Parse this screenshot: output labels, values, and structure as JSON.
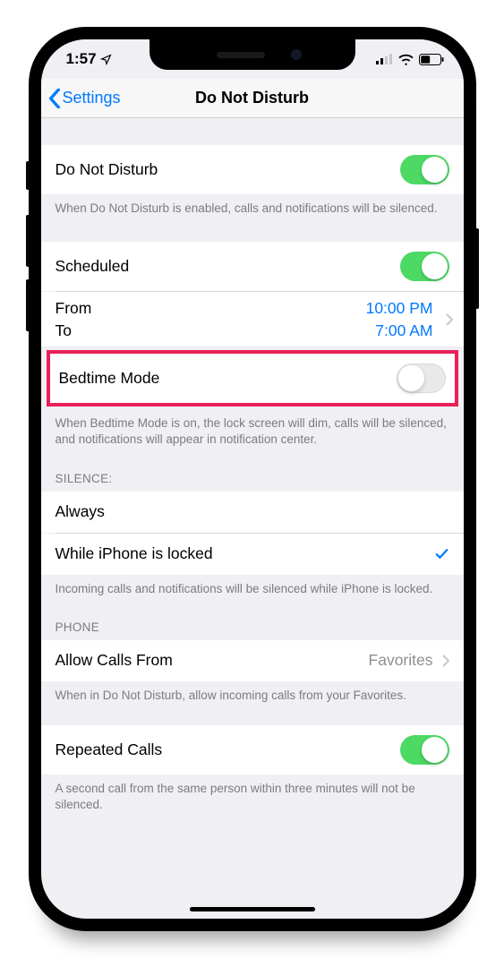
{
  "status": {
    "time": "1:57",
    "location_icon": "◤"
  },
  "nav": {
    "back_label": "Settings",
    "title": "Do Not Disturb"
  },
  "dnd": {
    "label": "Do Not Disturb",
    "footer": "When Do Not Disturb is enabled, calls and notifications will be silenced."
  },
  "scheduled": {
    "label": "Scheduled",
    "from_label": "From",
    "to_label": "To",
    "from_value": "10:00 PM",
    "to_value": "7:00 AM"
  },
  "bedtime": {
    "label": "Bedtime Mode",
    "footer": "When Bedtime Mode is on, the lock screen will dim, calls will be silenced, and notifications will appear in notification center."
  },
  "silence": {
    "header": "SILENCE:",
    "always": "Always",
    "locked": "While iPhone is locked",
    "footer": "Incoming calls and notifications will be silenced while iPhone is locked."
  },
  "phone": {
    "header": "PHONE",
    "allow_label": "Allow Calls From",
    "allow_value": "Favorites",
    "allow_footer": "When in Do Not Disturb, allow incoming calls from your Favorites.",
    "repeated_label": "Repeated Calls",
    "repeated_footer": "A second call from the same person within three minutes will not be silenced."
  }
}
